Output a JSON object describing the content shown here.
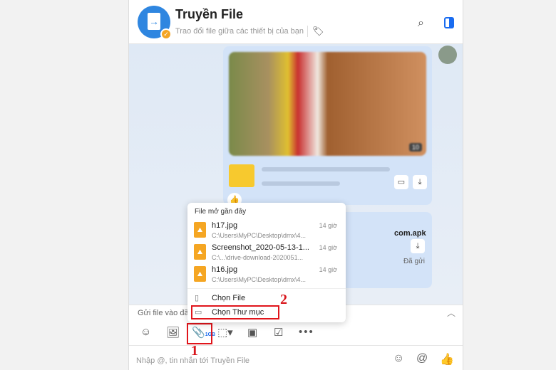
{
  "header": {
    "title": "Truyền File",
    "subtitle": "Trao đổi file giữa các thiết bị của bạn",
    "icons": [
      "tag-icon",
      "search-icon",
      "sidebar-toggle-icon"
    ]
  },
  "chat": {
    "album": {
      "count": "10"
    },
    "apk_message": {
      "filename_visible": "com.apk",
      "status": "Đã gửi"
    }
  },
  "popup": {
    "title": "File mở gần đây",
    "recent": [
      {
        "name": "h17.jpg",
        "path": "C:\\Users\\MyPC\\Desktop\\dmx\\4...",
        "time": "14 giờ"
      },
      {
        "name": "Screenshot_2020-05-13-1...",
        "path": "C:\\...\\drive-download-2020051...",
        "time": "14 giờ"
      },
      {
        "name": "h16.jpg",
        "path": "C:\\Users\\MyPC\\Desktop\\dmx\\4...",
        "time": "14 giờ"
      }
    ],
    "choose_file": "Chọn File",
    "choose_folder": "Chọn Thư mục"
  },
  "annotations": {
    "step1": "1",
    "step2": "2",
    "highlight_color": "#e0151b"
  },
  "send_bar": {
    "text": "Gửi file vào đã"
  },
  "toolbar": {
    "attach_badge": "1GB",
    "icons": [
      "sticker-icon",
      "image-icon",
      "attach-icon",
      "screenshot-icon",
      "contact-card-icon",
      "todo-icon",
      "more-icon"
    ]
  },
  "input": {
    "placeholder": "Nhập @, tin nhắn tới Truyền File"
  }
}
